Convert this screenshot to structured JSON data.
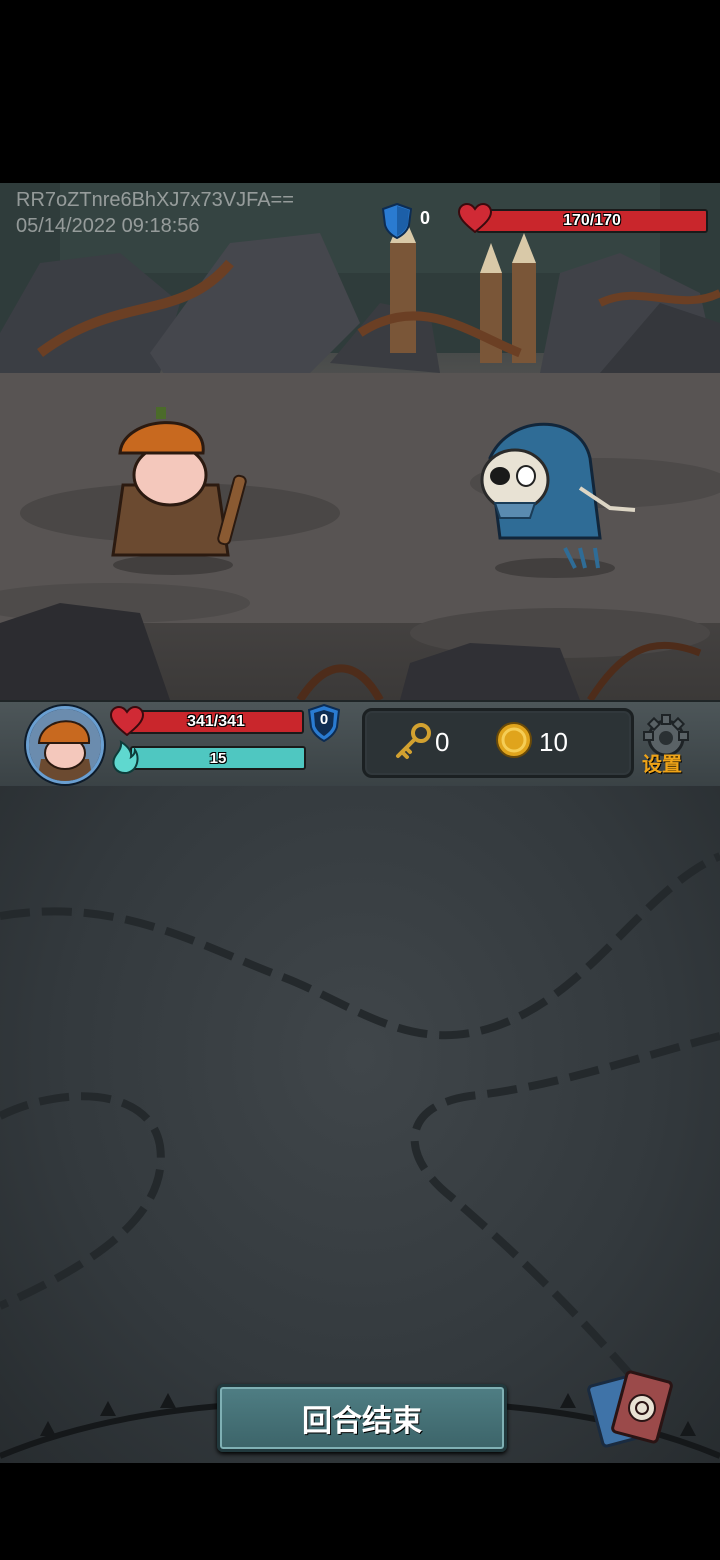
{
  "watermark": {
    "id_line": "RR7oZTnre6BhXJ7x73VJFA==",
    "timestamp": "05/14/2022 09:18:56"
  },
  "enemy": {
    "name_icon": "skeleton-enemy",
    "shield": "0",
    "hp_text": "170/170",
    "hp_fraction": 1.0
  },
  "player": {
    "portrait_icon": "pumpkin-hero-portrait",
    "hp_text": "341/341",
    "hp_fraction": 1.0,
    "shield": "0",
    "energy_text": "15",
    "energy_fraction": 1.0
  },
  "resources": {
    "keys": "0",
    "gold": "10"
  },
  "settings": {
    "label": "设置"
  },
  "end_turn": {
    "label": "回合结束"
  },
  "colors": {
    "hp": "#c9262c",
    "energy": "#4fc7c1",
    "shield": "#2a7bd1",
    "gold": "#e0a41c",
    "settings": "#f0a418"
  }
}
